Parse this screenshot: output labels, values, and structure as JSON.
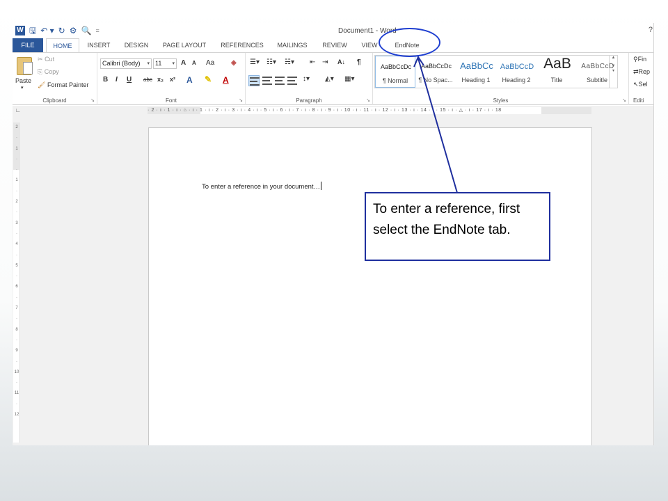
{
  "app": {
    "doc_title": "Document1 - Word",
    "help": "?"
  },
  "qat": {
    "save_icon": "save-icon",
    "undo_icon": "undo-icon",
    "redo_icon": "redo-icon"
  },
  "tabs": {
    "file": "FILE",
    "home": "HOME",
    "insert": "INSERT",
    "design": "DESIGN",
    "page_layout": "PAGE LAYOUT",
    "references": "REFERENCES",
    "mailings": "MAILINGS",
    "review": "REVIEW",
    "view": "VIEW",
    "endnote": "EndNote"
  },
  "clipboard": {
    "paste": "Paste",
    "cut": "Cut",
    "copy": "Copy",
    "format_painter": "Format Painter",
    "label": "Clipboard"
  },
  "font": {
    "name": "Calibri (Body)",
    "size": "11",
    "grow": "A",
    "shrink": "A",
    "change_case": "Aa",
    "bold": "B",
    "italic": "I",
    "underline": "U",
    "strike": "abc",
    "sub": "x₂",
    "sup": "x²",
    "text_effects": "A",
    "font_color": "A",
    "label": "Font"
  },
  "paragraph": {
    "sort": "A↓",
    "pilcrow": "¶",
    "label": "Paragraph"
  },
  "styles": {
    "items": [
      {
        "preview": "AaBbCcDc",
        "name": "¶ Normal"
      },
      {
        "preview": "AaBbCcDc",
        "name": "¶ No Spac..."
      },
      {
        "preview": "AaBbCc",
        "name": "Heading 1"
      },
      {
        "preview": "AaBbCcD",
        "name": "Heading 2"
      },
      {
        "preview": "AaB",
        "name": "Title"
      },
      {
        "preview": "AaBbCcD",
        "name": "Subtitle"
      }
    ],
    "label": "Styles"
  },
  "editing": {
    "find": "Fin",
    "replace": "Rep",
    "select": "Sel",
    "label": "Editi"
  },
  "ruler": {
    "horizontal": "· 2 · ı · 1 · ı · ⌂ · ı · 1 · ı · 2 · ı · 3 · ı · 4 · ı · 5 · ı · 6 · ı · 7 · ı · 8 · ı · 9 · ı · 10 · ı · 11 · ı · 12 · ı · 13 · ı · 14 · ı · 15 · ı · △ · ı · 17 · ı · 18",
    "vertical": [
      "2",
      "·",
      "1",
      "·",
      "·",
      "1",
      "·",
      "2",
      "·",
      "3",
      "·",
      "4",
      "·",
      "5",
      "·",
      "6",
      "·",
      "7",
      "·",
      "8",
      "·",
      "9",
      "·",
      "10",
      "·",
      "11",
      "·",
      "12"
    ]
  },
  "document": {
    "text": "To enter a reference in your document…"
  },
  "callout": {
    "text": "To enter a reference, first select the EndNote tab."
  },
  "colors": {
    "word_blue": "#2b579a",
    "annotation_blue": "#1f2f9e"
  }
}
